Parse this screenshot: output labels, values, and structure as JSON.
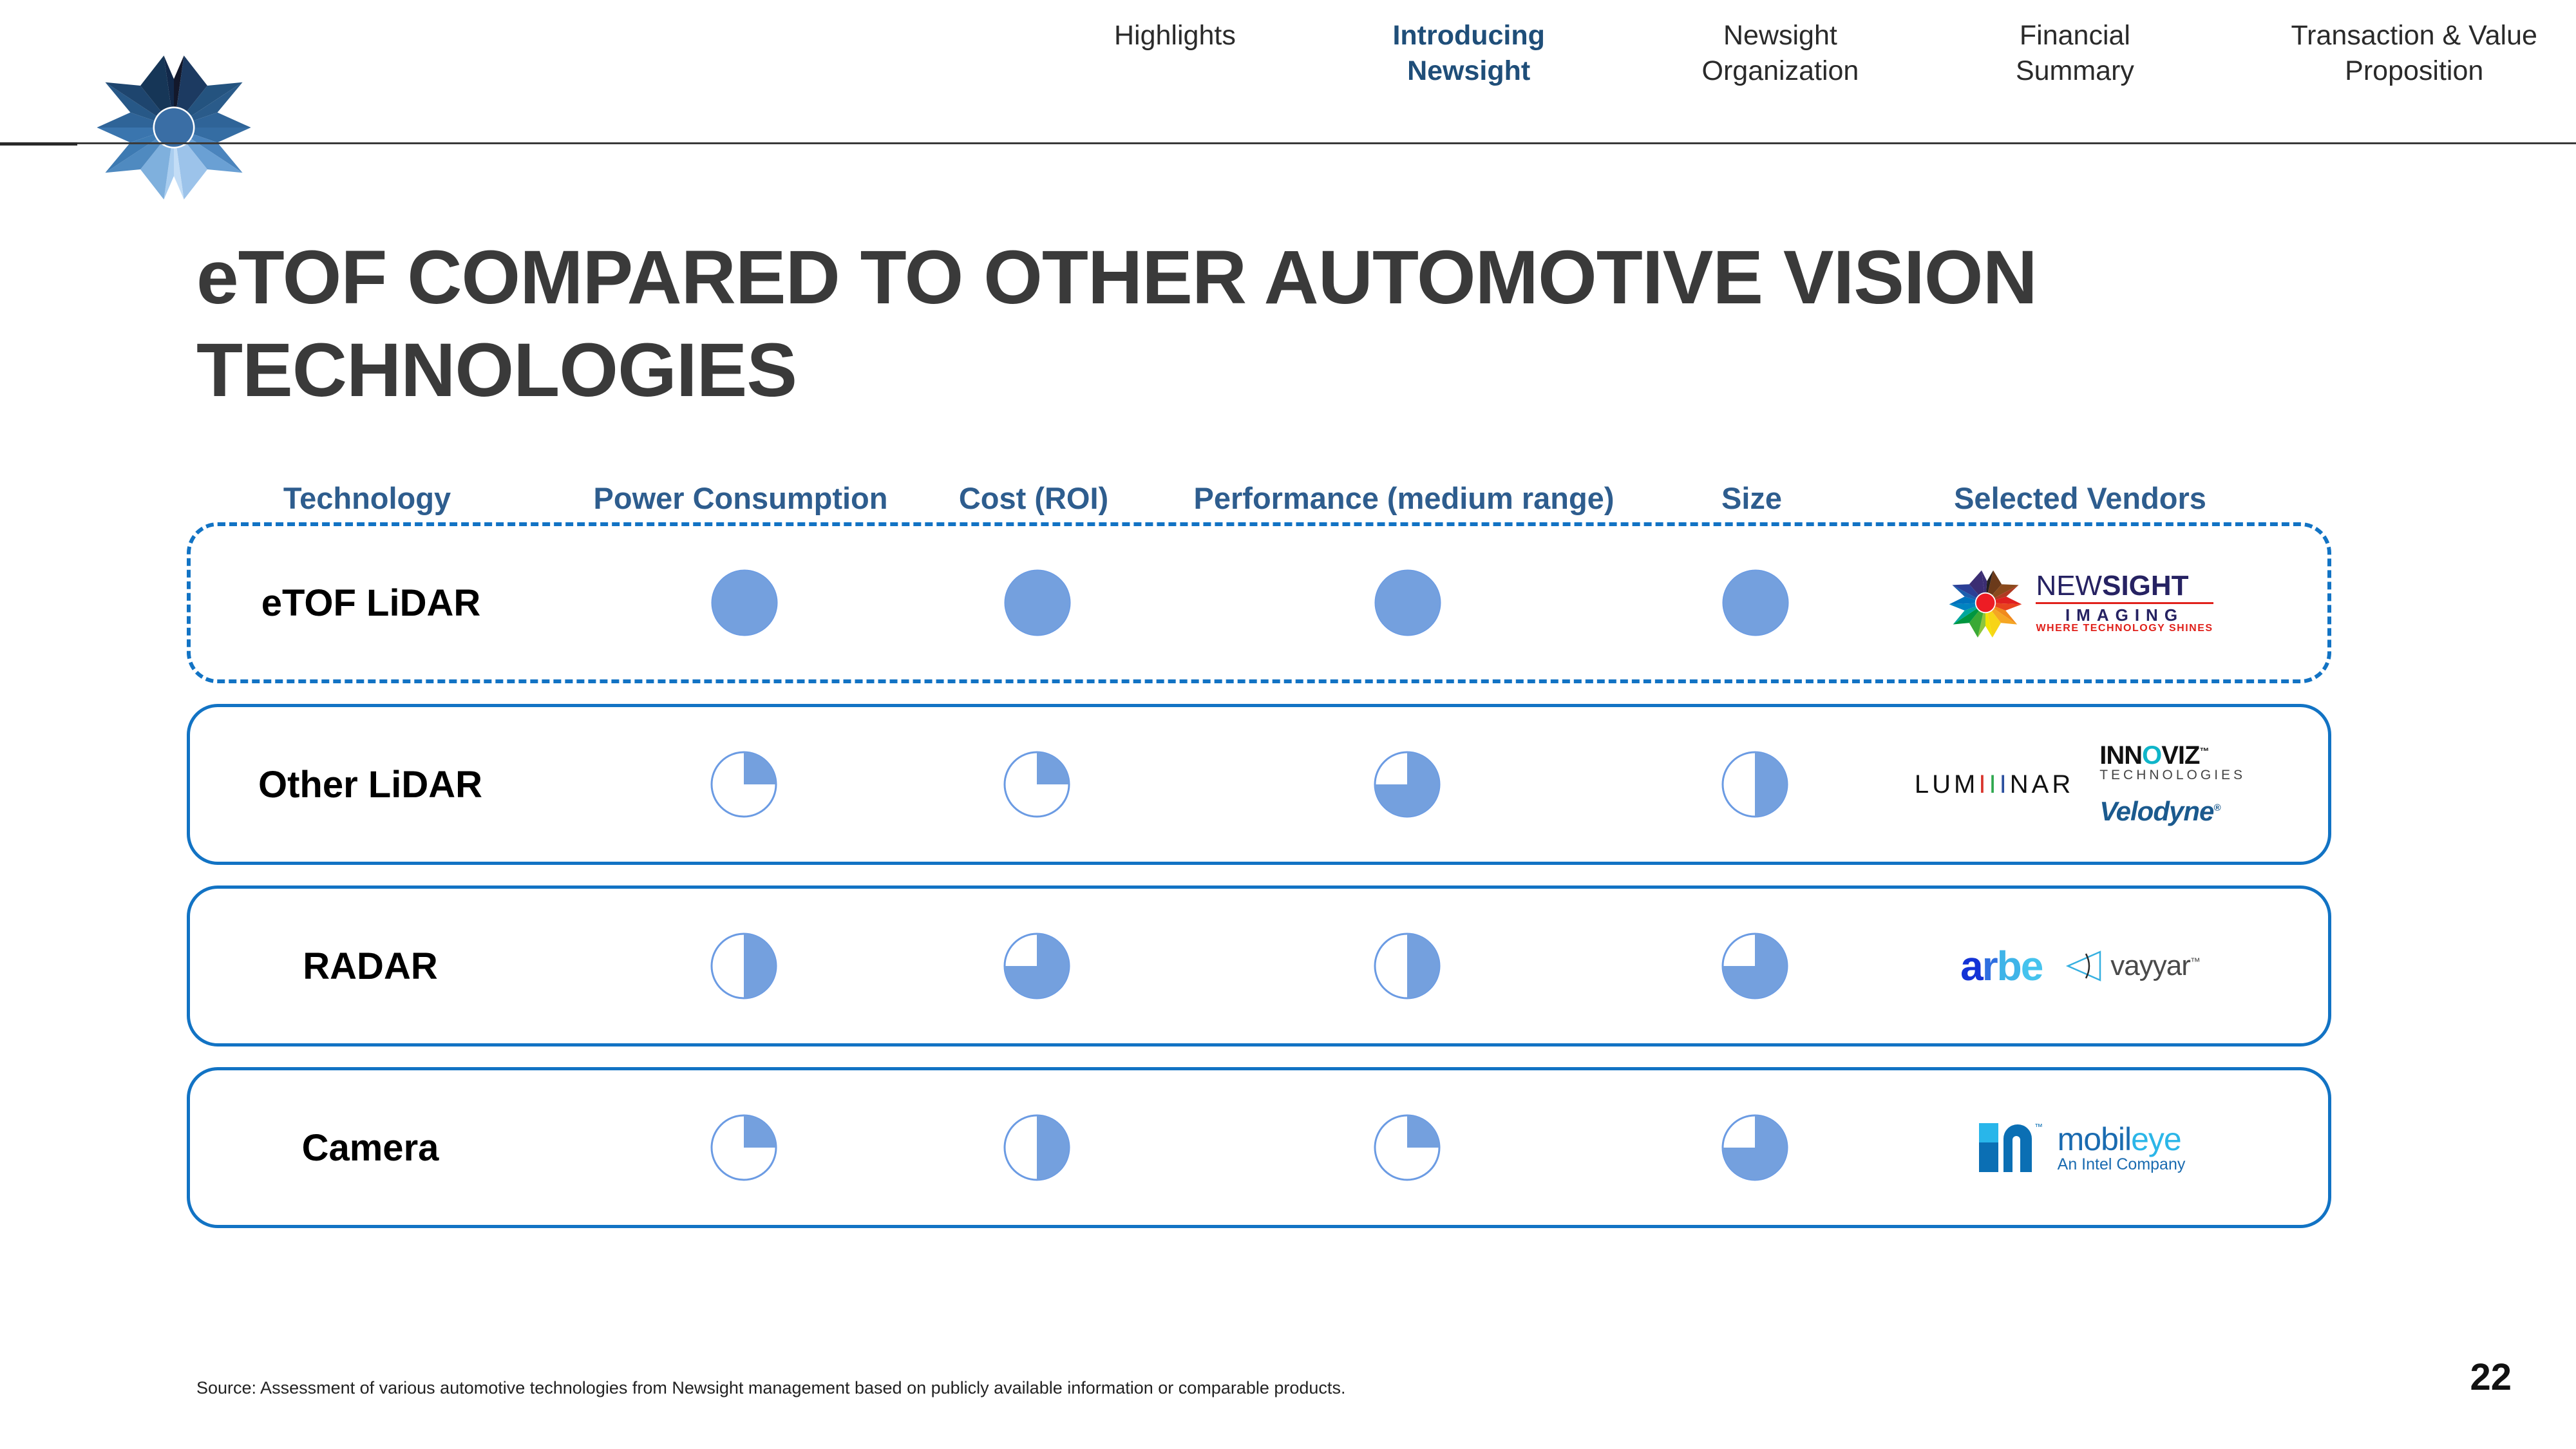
{
  "nav": {
    "items": [
      {
        "label": "Highlights",
        "active": false
      },
      {
        "label": "Introducing\nNewsight",
        "active": true
      },
      {
        "label": "Newsight\nOrganization",
        "active": false
      },
      {
        "label": "Financial\nSummary",
        "active": false
      },
      {
        "label": "Transaction & Value\nProposition",
        "active": false
      }
    ]
  },
  "title": "eTOF COMPARED TO OTHER AUTOMOTIVE VISION TECHNOLOGIES",
  "chart_data": {
    "type": "table",
    "title": "eTOF COMPARED TO OTHER AUTOMOTIVE VISION TECHNOLOGIES",
    "columns": [
      "Technology",
      "Power Consumption",
      "Cost (ROI)",
      "Performance (medium range)",
      "Size",
      "Selected Vendors"
    ],
    "rating_scale_note": "Harvey-ball pie fill fraction, 0-100%",
    "rows": [
      {
        "technology": "eTOF LiDAR",
        "highlighted": true,
        "power_consumption": 100,
        "cost_roi": 100,
        "performance_medium_range": 100,
        "size": 100,
        "vendors": [
          "Newsight Imaging"
        ]
      },
      {
        "technology": "Other LiDAR",
        "highlighted": false,
        "power_consumption": 25,
        "cost_roi": 25,
        "performance_medium_range": 75,
        "size": 50,
        "vendors": [
          "LUMINAR",
          "INNOVIZ TECHNOLOGIES",
          "Velodyne"
        ]
      },
      {
        "technology": "RADAR",
        "highlighted": false,
        "power_consumption": 50,
        "cost_roi": 75,
        "performance_medium_range": 50,
        "size": 75,
        "vendors": [
          "arbe",
          "vayyar"
        ]
      },
      {
        "technology": "Camera",
        "highlighted": false,
        "power_consumption": 25,
        "cost_roi": 50,
        "performance_medium_range": 25,
        "size": 75,
        "vendors": [
          "mobileye An Intel Company"
        ]
      }
    ],
    "colors": {
      "fill": "#74A0DE",
      "stroke": "#6B9BE3",
      "header_text": "#2E5D8E",
      "row_border": "#1273C4"
    }
  },
  "vendor_logos": {
    "newsight": {
      "line1_a": "NEW",
      "line1_b": "SIGHT",
      "line2": "IMAGING",
      "line3": "WHERE TECHNOLOGY SHINES"
    },
    "luminar": {
      "p1": "LUM",
      "i1": "I",
      "i2": "I",
      "i3": "I",
      "p2": "NAR"
    },
    "innoviz": {
      "t1a": "INN",
      "t1o": "O",
      "t1b": "VIZ",
      "tm": "™",
      "t2": "TECHNOLOGIES"
    },
    "velodyne": {
      "text": "Velodyne",
      "mark": "®"
    },
    "arbe": {
      "a": "a",
      "r": "r",
      "b": "b",
      "e": "e"
    },
    "vayyar": {
      "text": "vayyar",
      "mark": "™"
    },
    "mobileye": {
      "m1a": "mobil",
      "m1b": "eye",
      "tm": "™",
      "m2": "An Intel Company"
    }
  },
  "footer": {
    "source": "Source: Assessment of various automotive technologies from Newsight management based on publicly available information or comparable products.",
    "page_number": "22"
  }
}
